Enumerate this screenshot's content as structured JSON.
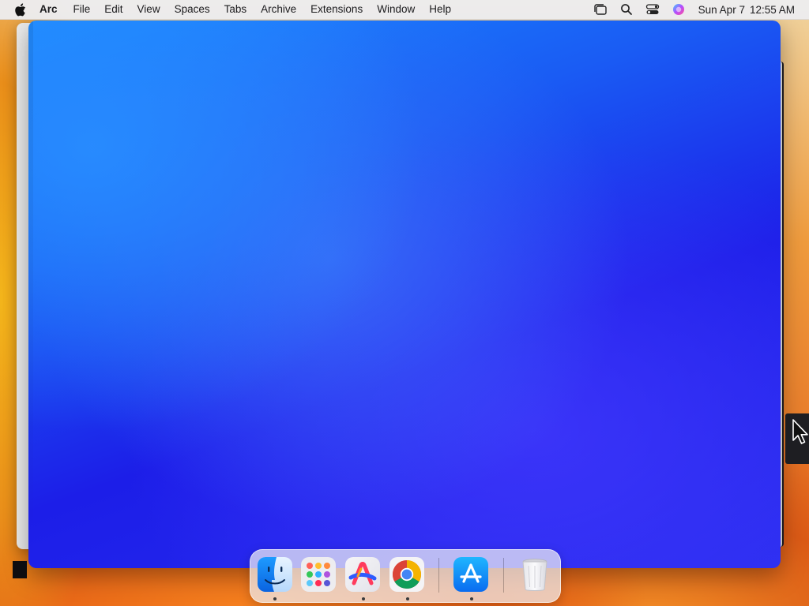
{
  "menubar": {
    "apple_icon": "apple-logo-icon",
    "app_name": "Arc",
    "items": [
      "File",
      "Edit",
      "View",
      "Spaces",
      "Tabs",
      "Archive",
      "Extensions",
      "Window",
      "Help"
    ],
    "status_icons": [
      "stage-manager-icon",
      "spotlight-search-icon",
      "control-center-icon",
      "siri-icon"
    ],
    "clock": {
      "date": "Sun Apr 7",
      "time": "12:55 AM"
    }
  },
  "window": {
    "app": "Arc",
    "gradient_colors": [
      "#1b8cff",
      "#1a5cf4",
      "#1c1ee8",
      "#2a2df0"
    ]
  },
  "dock": {
    "apps": [
      {
        "name": "Finder",
        "icon": "finder-icon",
        "running": true
      },
      {
        "name": "Launchpad",
        "icon": "launchpad-icon",
        "running": false
      },
      {
        "name": "Arc",
        "icon": "arc-browser-icon",
        "running": true
      },
      {
        "name": "Google Chrome",
        "icon": "chrome-icon",
        "running": true
      },
      {
        "name": "App Store",
        "icon": "app-store-icon",
        "running": true
      },
      {
        "name": "Trash",
        "icon": "trash-icon",
        "running": false
      }
    ]
  },
  "colors": {
    "menubar_bg": "#ececee",
    "wallpaper_accent": "#e98e1a",
    "dock_bg": "#f0f0f4"
  }
}
